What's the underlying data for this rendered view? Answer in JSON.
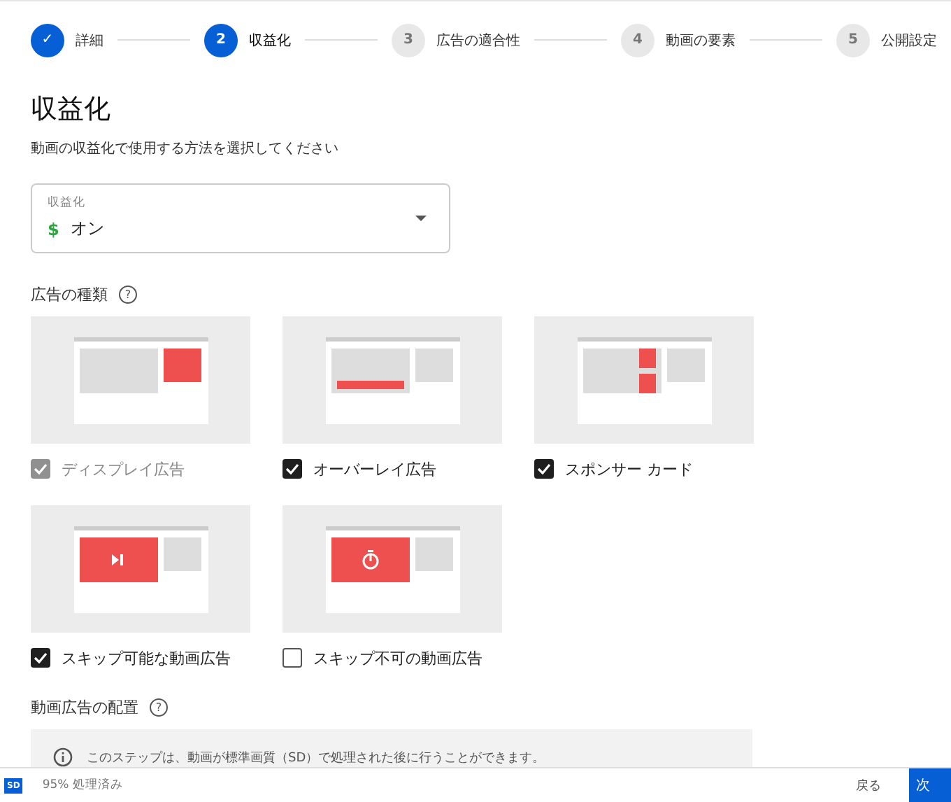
{
  "steps": [
    {
      "kind": "done",
      "marker": "✓",
      "label": "詳細",
      "selected": false
    },
    {
      "kind": "current",
      "marker": "2",
      "label": "収益化",
      "selected": true
    },
    {
      "kind": "pending",
      "marker": "3",
      "label": "広告の適合性",
      "selected": false
    },
    {
      "kind": "pending",
      "marker": "4",
      "label": "動画の要素",
      "selected": false
    },
    {
      "kind": "pending",
      "marker": "5",
      "label": "公開設定",
      "selected": false
    }
  ],
  "title": "収益化",
  "subtitle": "動画の収益化で使用する方法を選択してください",
  "monetization_select": {
    "label": "収益化",
    "icon": "$",
    "value": "オン"
  },
  "ad_types": {
    "heading": "広告の種類",
    "help": "?",
    "items": [
      {
        "kind": "display",
        "label": "ディスプレイ広告",
        "checked": true,
        "disabled": true
      },
      {
        "kind": "overlay",
        "label": "オーバーレイ広告",
        "checked": true,
        "disabled": false
      },
      {
        "kind": "sponsor",
        "label": "スポンサー カード",
        "checked": true,
        "disabled": false
      },
      {
        "kind": "skippable",
        "label": "スキップ可能な動画広告",
        "checked": true,
        "disabled": false
      },
      {
        "kind": "nonskippable",
        "label": "スキップ不可の動画広告",
        "checked": false,
        "disabled": false
      }
    ]
  },
  "placement": {
    "heading": "動画広告の配置",
    "help": "?",
    "info": "このステップは、動画が標準画質（SD）で処理された後に行うことができます。"
  },
  "footer": {
    "badge": "SD",
    "status": "95% 処理済み",
    "back": "戻る",
    "next": "次"
  }
}
